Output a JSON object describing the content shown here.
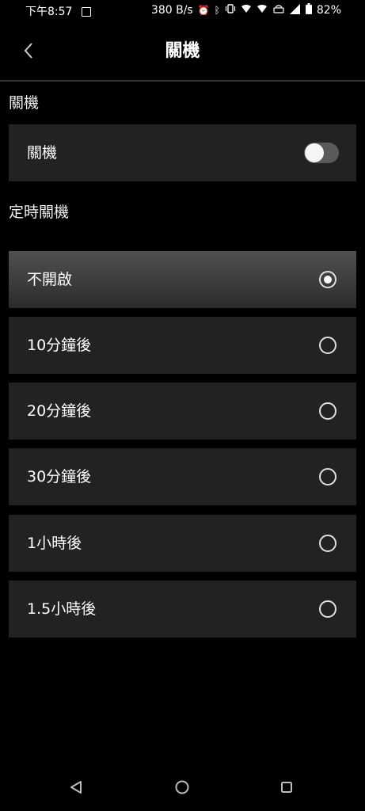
{
  "status_bar": {
    "time": "下午8:57",
    "network_speed": "380 B/s",
    "battery": "82%"
  },
  "header": {
    "title": "關機"
  },
  "sections": {
    "shutdown_label": "關機",
    "timer_label": "定時關機"
  },
  "shutdown_row": {
    "label": "關機",
    "toggle_on": false
  },
  "timer_options": [
    {
      "label": "不開啟",
      "selected": true
    },
    {
      "label": "10分鐘後",
      "selected": false
    },
    {
      "label": "20分鐘後",
      "selected": false
    },
    {
      "label": "30分鐘後",
      "selected": false
    },
    {
      "label": "1小時後",
      "selected": false
    },
    {
      "label": "1.5小時後",
      "selected": false
    }
  ],
  "colors": {
    "background": "#000000",
    "card": "#222222",
    "selected_card": "#4a4a4a",
    "toggle_track": "#5a5a5a"
  }
}
